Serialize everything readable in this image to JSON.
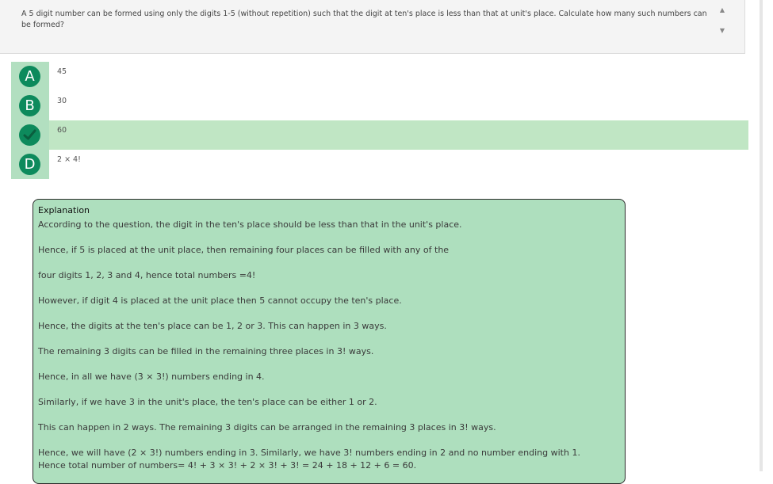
{
  "question": {
    "text": "A 5 digit number can be formed using only the digits 1-5 (without repetition) such that the digit at ten's place is less than that at unit's place. Calculate how many such numbers can be formed?",
    "scroll_up_icon": "triangle-up-icon",
    "scroll_down_icon": "triangle-down-icon"
  },
  "options": [
    {
      "letter": "A",
      "value": "45",
      "correct": false
    },
    {
      "letter": "B",
      "value": "30",
      "correct": false
    },
    {
      "letter": "",
      "value": "60",
      "correct": true,
      "icon": "check-icon"
    },
    {
      "letter": "D",
      "value": "2 × 4!",
      "correct": false
    }
  ],
  "colors": {
    "accent": "#0d8a5c",
    "option_letter_bg": "#b2dfc0",
    "correct_row_bg": "#c0e6c4",
    "explanation_bg": "#aedfbe"
  },
  "explanation": {
    "title": "Explanation",
    "lines": [
      "According to the question, the digit in the ten's place should be less than that in the unit's place.",
      "Hence, if 5 is placed at the unit place, then remaining four places can be filled with any of the",
      "four digits 1, 2, 3 and 4, hence total numbers =4!",
      "However, if digit 4 is placed at the unit place then 5 cannot occupy the ten's place.",
      "Hence, the digits at the ten's place can be 1, 2 or 3. This can happen in 3 ways.",
      "The remaining 3 digits can be filled in the remaining three places in 3! ways.",
      "Hence, in all we have (3 × 3!) numbers ending in 4.",
      "Similarly, if we have 3 in the unit's place, the ten's place can be either 1 or 2.",
      "This can happen in 2 ways. The remaining 3 digits can be arranged in the remaining 3 places in 3! ways.",
      "Hence, we will have (2 × 3!) numbers ending in 3. Similarly, we have 3! numbers ending in 2 and no number ending with 1. Hence total number of numbers= 4! + 3 × 3! + 2 × 3! + 3! = 24 + 18 + 12 + 6 = 60."
    ]
  }
}
